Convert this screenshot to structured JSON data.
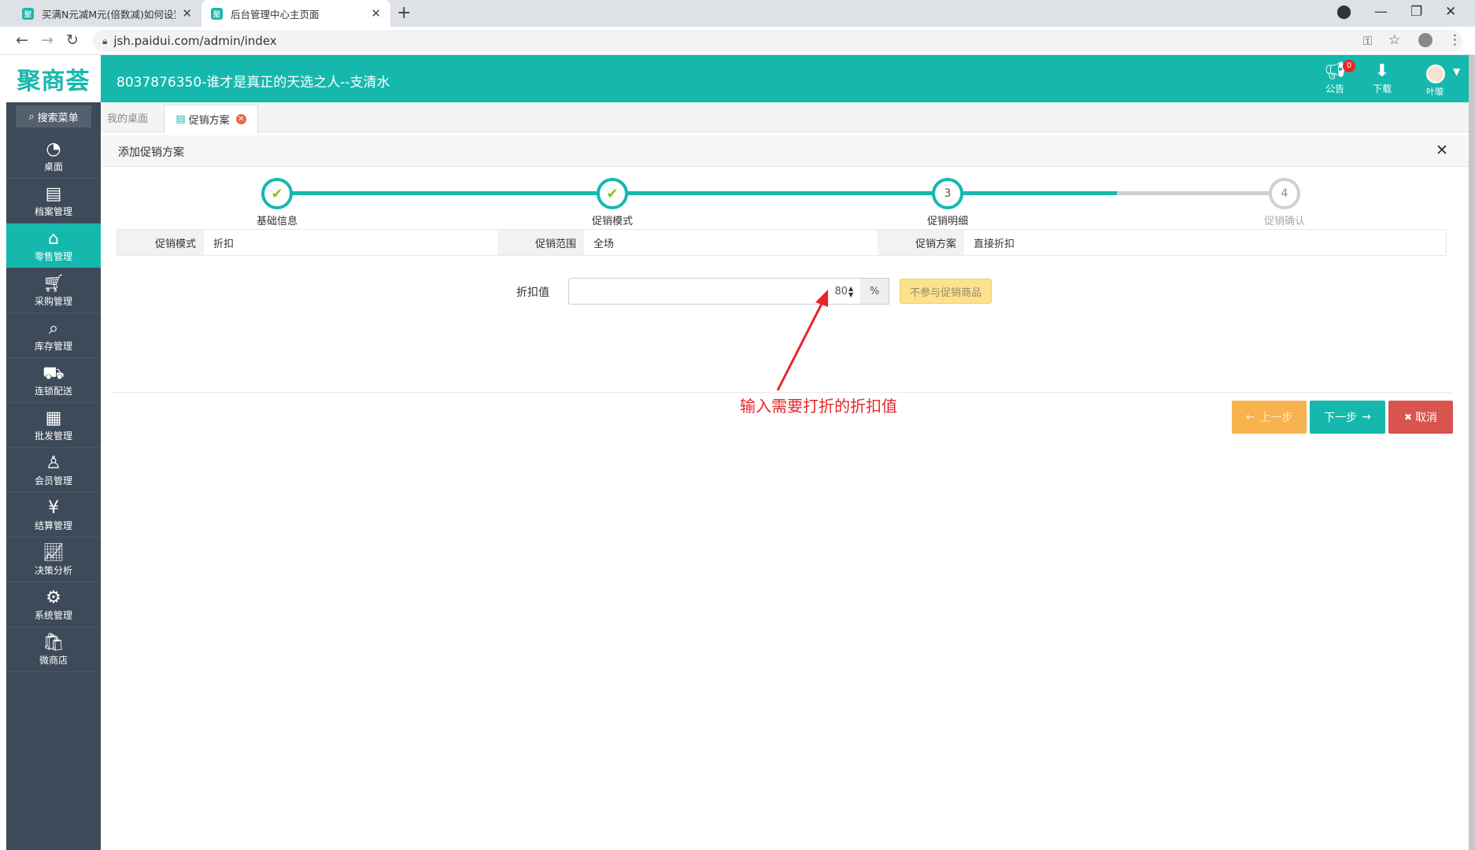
{
  "browser": {
    "tabs": [
      {
        "title": "买满N元减M元(倍数减)如何设置",
        "favicon": "聚"
      },
      {
        "title": "后台管理中心主页面",
        "favicon": "聚"
      }
    ],
    "new_tab": "+",
    "url": "jsh.paidui.com/admin/index"
  },
  "header": {
    "logo": "聚商荟",
    "title": "8037876350-谁才是真正的天选之人--支清水",
    "notice_label": "公告",
    "notice_badge": "0",
    "download_label": "下载",
    "user_name": "叶璇"
  },
  "sidebar": {
    "search_label": "搜索菜单",
    "items": [
      {
        "label": "桌面",
        "icon": "dashboard-icon"
      },
      {
        "label": "档案管理",
        "icon": "archive-icon"
      },
      {
        "label": "零售管理",
        "icon": "store-icon",
        "active": true
      },
      {
        "label": "采购管理",
        "icon": "purchase-icon"
      },
      {
        "label": "库存管理",
        "icon": "inventory-icon"
      },
      {
        "label": "连锁配送",
        "icon": "delivery-icon"
      },
      {
        "label": "批发管理",
        "icon": "wholesale-icon"
      },
      {
        "label": "会员管理",
        "icon": "member-icon"
      },
      {
        "label": "结算管理",
        "icon": "settlement-icon"
      },
      {
        "label": "决策分析",
        "icon": "analysis-icon"
      },
      {
        "label": "系统管理",
        "icon": "settings-icon"
      },
      {
        "label": "微商店",
        "icon": "microstore-icon"
      }
    ]
  },
  "app_tabs": {
    "desk": "我的桌面",
    "promo": "促销方案"
  },
  "dialog": {
    "title": "添加促销方案",
    "steps": [
      {
        "label": "基础信息",
        "state": "done",
        "mark": "✔"
      },
      {
        "label": "促销模式",
        "state": "done",
        "mark": "✔"
      },
      {
        "label": "促销明细",
        "state": "current",
        "mark": "3"
      },
      {
        "label": "促销确认",
        "state": "todo",
        "mark": "4"
      }
    ],
    "info": [
      {
        "label": "促销模式",
        "value": "折扣"
      },
      {
        "label": "促销范围",
        "value": "全场"
      },
      {
        "label": "促销方案",
        "value": "直接折扣"
      }
    ],
    "discount_label": "折扣值",
    "discount_value": "80",
    "discount_unit": "%",
    "exclude_button": "不参与促销商品",
    "prev_button": "上一步",
    "next_button": "下一步",
    "cancel_button": "取消"
  },
  "annotation": {
    "text": "输入需要打折的折扣值",
    "color": "#e8262a"
  },
  "colors": {
    "accent": "#16b8ad",
    "sidebar": "#3d4a59",
    "warning": "#f8b24d",
    "danger": "#d9534f"
  }
}
